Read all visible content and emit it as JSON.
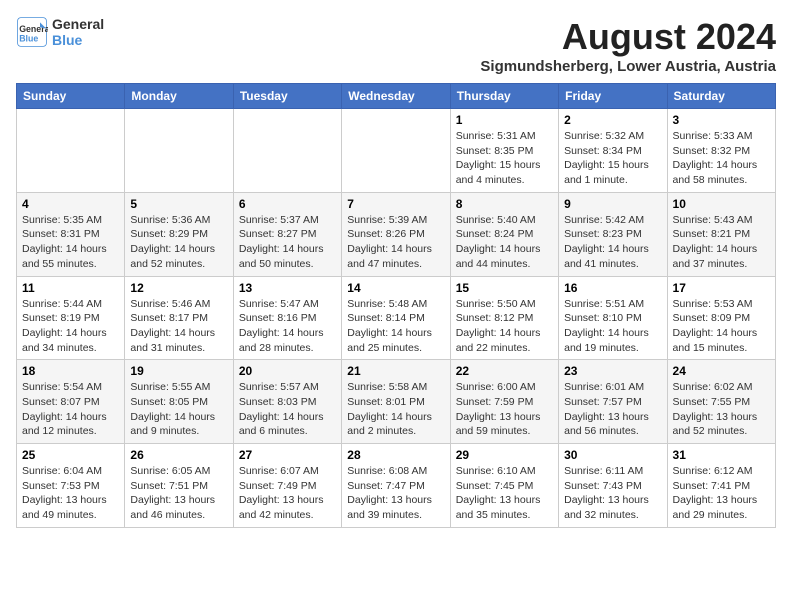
{
  "header": {
    "logo_line1": "General",
    "logo_line2": "Blue",
    "month_year": "August 2024",
    "location": "Sigmundsherberg, Lower Austria, Austria"
  },
  "days_of_week": [
    "Sunday",
    "Monday",
    "Tuesday",
    "Wednesday",
    "Thursday",
    "Friday",
    "Saturday"
  ],
  "weeks": [
    [
      {
        "day": "",
        "info": ""
      },
      {
        "day": "",
        "info": ""
      },
      {
        "day": "",
        "info": ""
      },
      {
        "day": "",
        "info": ""
      },
      {
        "day": "1",
        "info": "Sunrise: 5:31 AM\nSunset: 8:35 PM\nDaylight: 15 hours\nand 4 minutes."
      },
      {
        "day": "2",
        "info": "Sunrise: 5:32 AM\nSunset: 8:34 PM\nDaylight: 15 hours\nand 1 minute."
      },
      {
        "day": "3",
        "info": "Sunrise: 5:33 AM\nSunset: 8:32 PM\nDaylight: 14 hours\nand 58 minutes."
      }
    ],
    [
      {
        "day": "4",
        "info": "Sunrise: 5:35 AM\nSunset: 8:31 PM\nDaylight: 14 hours\nand 55 minutes."
      },
      {
        "day": "5",
        "info": "Sunrise: 5:36 AM\nSunset: 8:29 PM\nDaylight: 14 hours\nand 52 minutes."
      },
      {
        "day": "6",
        "info": "Sunrise: 5:37 AM\nSunset: 8:27 PM\nDaylight: 14 hours\nand 50 minutes."
      },
      {
        "day": "7",
        "info": "Sunrise: 5:39 AM\nSunset: 8:26 PM\nDaylight: 14 hours\nand 47 minutes."
      },
      {
        "day": "8",
        "info": "Sunrise: 5:40 AM\nSunset: 8:24 PM\nDaylight: 14 hours\nand 44 minutes."
      },
      {
        "day": "9",
        "info": "Sunrise: 5:42 AM\nSunset: 8:23 PM\nDaylight: 14 hours\nand 41 minutes."
      },
      {
        "day": "10",
        "info": "Sunrise: 5:43 AM\nSunset: 8:21 PM\nDaylight: 14 hours\nand 37 minutes."
      }
    ],
    [
      {
        "day": "11",
        "info": "Sunrise: 5:44 AM\nSunset: 8:19 PM\nDaylight: 14 hours\nand 34 minutes."
      },
      {
        "day": "12",
        "info": "Sunrise: 5:46 AM\nSunset: 8:17 PM\nDaylight: 14 hours\nand 31 minutes."
      },
      {
        "day": "13",
        "info": "Sunrise: 5:47 AM\nSunset: 8:16 PM\nDaylight: 14 hours\nand 28 minutes."
      },
      {
        "day": "14",
        "info": "Sunrise: 5:48 AM\nSunset: 8:14 PM\nDaylight: 14 hours\nand 25 minutes."
      },
      {
        "day": "15",
        "info": "Sunrise: 5:50 AM\nSunset: 8:12 PM\nDaylight: 14 hours\nand 22 minutes."
      },
      {
        "day": "16",
        "info": "Sunrise: 5:51 AM\nSunset: 8:10 PM\nDaylight: 14 hours\nand 19 minutes."
      },
      {
        "day": "17",
        "info": "Sunrise: 5:53 AM\nSunset: 8:09 PM\nDaylight: 14 hours\nand 15 minutes."
      }
    ],
    [
      {
        "day": "18",
        "info": "Sunrise: 5:54 AM\nSunset: 8:07 PM\nDaylight: 14 hours\nand 12 minutes."
      },
      {
        "day": "19",
        "info": "Sunrise: 5:55 AM\nSunset: 8:05 PM\nDaylight: 14 hours\nand 9 minutes."
      },
      {
        "day": "20",
        "info": "Sunrise: 5:57 AM\nSunset: 8:03 PM\nDaylight: 14 hours\nand 6 minutes."
      },
      {
        "day": "21",
        "info": "Sunrise: 5:58 AM\nSunset: 8:01 PM\nDaylight: 14 hours\nand 2 minutes."
      },
      {
        "day": "22",
        "info": "Sunrise: 6:00 AM\nSunset: 7:59 PM\nDaylight: 13 hours\nand 59 minutes."
      },
      {
        "day": "23",
        "info": "Sunrise: 6:01 AM\nSunset: 7:57 PM\nDaylight: 13 hours\nand 56 minutes."
      },
      {
        "day": "24",
        "info": "Sunrise: 6:02 AM\nSunset: 7:55 PM\nDaylight: 13 hours\nand 52 minutes."
      }
    ],
    [
      {
        "day": "25",
        "info": "Sunrise: 6:04 AM\nSunset: 7:53 PM\nDaylight: 13 hours\nand 49 minutes."
      },
      {
        "day": "26",
        "info": "Sunrise: 6:05 AM\nSunset: 7:51 PM\nDaylight: 13 hours\nand 46 minutes."
      },
      {
        "day": "27",
        "info": "Sunrise: 6:07 AM\nSunset: 7:49 PM\nDaylight: 13 hours\nand 42 minutes."
      },
      {
        "day": "28",
        "info": "Sunrise: 6:08 AM\nSunset: 7:47 PM\nDaylight: 13 hours\nand 39 minutes."
      },
      {
        "day": "29",
        "info": "Sunrise: 6:10 AM\nSunset: 7:45 PM\nDaylight: 13 hours\nand 35 minutes."
      },
      {
        "day": "30",
        "info": "Sunrise: 6:11 AM\nSunset: 7:43 PM\nDaylight: 13 hours\nand 32 minutes."
      },
      {
        "day": "31",
        "info": "Sunrise: 6:12 AM\nSunset: 7:41 PM\nDaylight: 13 hours\nand 29 minutes."
      }
    ]
  ]
}
